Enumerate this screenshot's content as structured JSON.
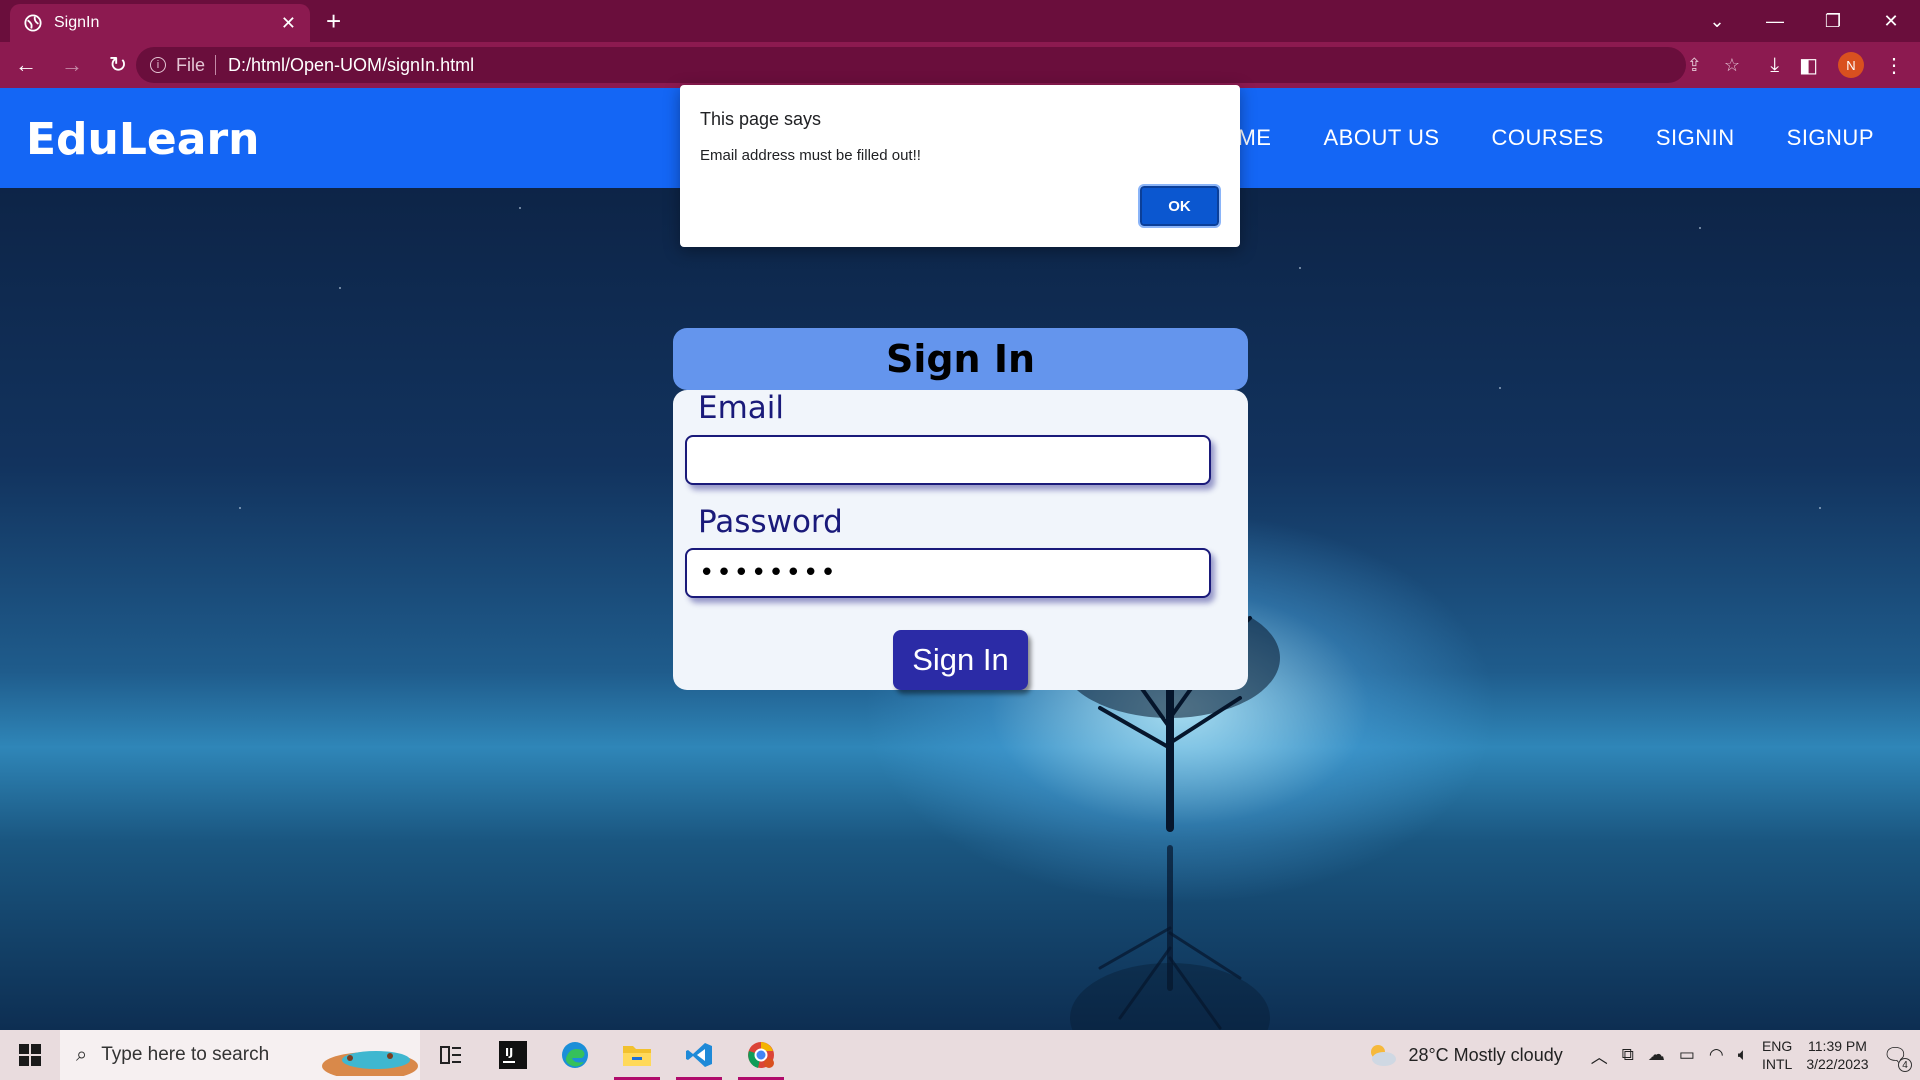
{
  "browser": {
    "tab_title": "SignIn",
    "tab_close": "✕",
    "new_tab": "+",
    "url_scheme": "File",
    "url": "D:/html/Open-UOM/signIn.html",
    "profile_initial": "N",
    "window_controls": [
      "⌄",
      "—",
      "❐",
      "✕"
    ]
  },
  "site": {
    "logo": "EduLearn",
    "menu": [
      "OME",
      "ABOUT US",
      "COURSES",
      "SIGNIN",
      "SIGNUP"
    ]
  },
  "signin": {
    "heading": "Sign In",
    "email_label": "Email",
    "email_value": "",
    "password_label": "Password",
    "password_value": "••••••••",
    "submit_label": "Sign In"
  },
  "alert": {
    "title": "This page says",
    "message": "Email address must be filled out!!",
    "ok_label": "OK"
  },
  "taskbar": {
    "search_placeholder": "Type here to search",
    "weather": "28°C  Mostly cloudy",
    "lang_top": "ENG",
    "lang_bottom": "INTL",
    "time": "11:39 PM",
    "date": "3/22/2023",
    "notification_count": "4"
  },
  "colors": {
    "browser_frame": "#6a0e3c",
    "browser_toolbar": "#8c1a50",
    "site_nav": "#1466f5",
    "card_header": "#6495ed",
    "submit_button": "#2b2ba6",
    "alert_ok": "#0b57d0"
  }
}
